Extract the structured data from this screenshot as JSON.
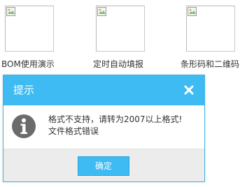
{
  "gallery": {
    "items": [
      {
        "label": "BOM使用演示",
        "thumbnail": "broken-image"
      },
      {
        "label": "定时自动填报",
        "thumbnail": "broken-image"
      },
      {
        "label": "条形码和二维码",
        "thumbnail": "broken-image"
      }
    ]
  },
  "dialog": {
    "title": "提示",
    "close_icon": "close-icon",
    "icon": "info-icon",
    "message_line1": "格式不支持，请转为2007以上格式!",
    "message_line2": "文件格式错误",
    "ok_label": "确定"
  },
  "colors": {
    "header": "#3ebbf2",
    "button": "#3ebbf2",
    "footer": "#ececec",
    "icon": "#6b6b6b"
  }
}
